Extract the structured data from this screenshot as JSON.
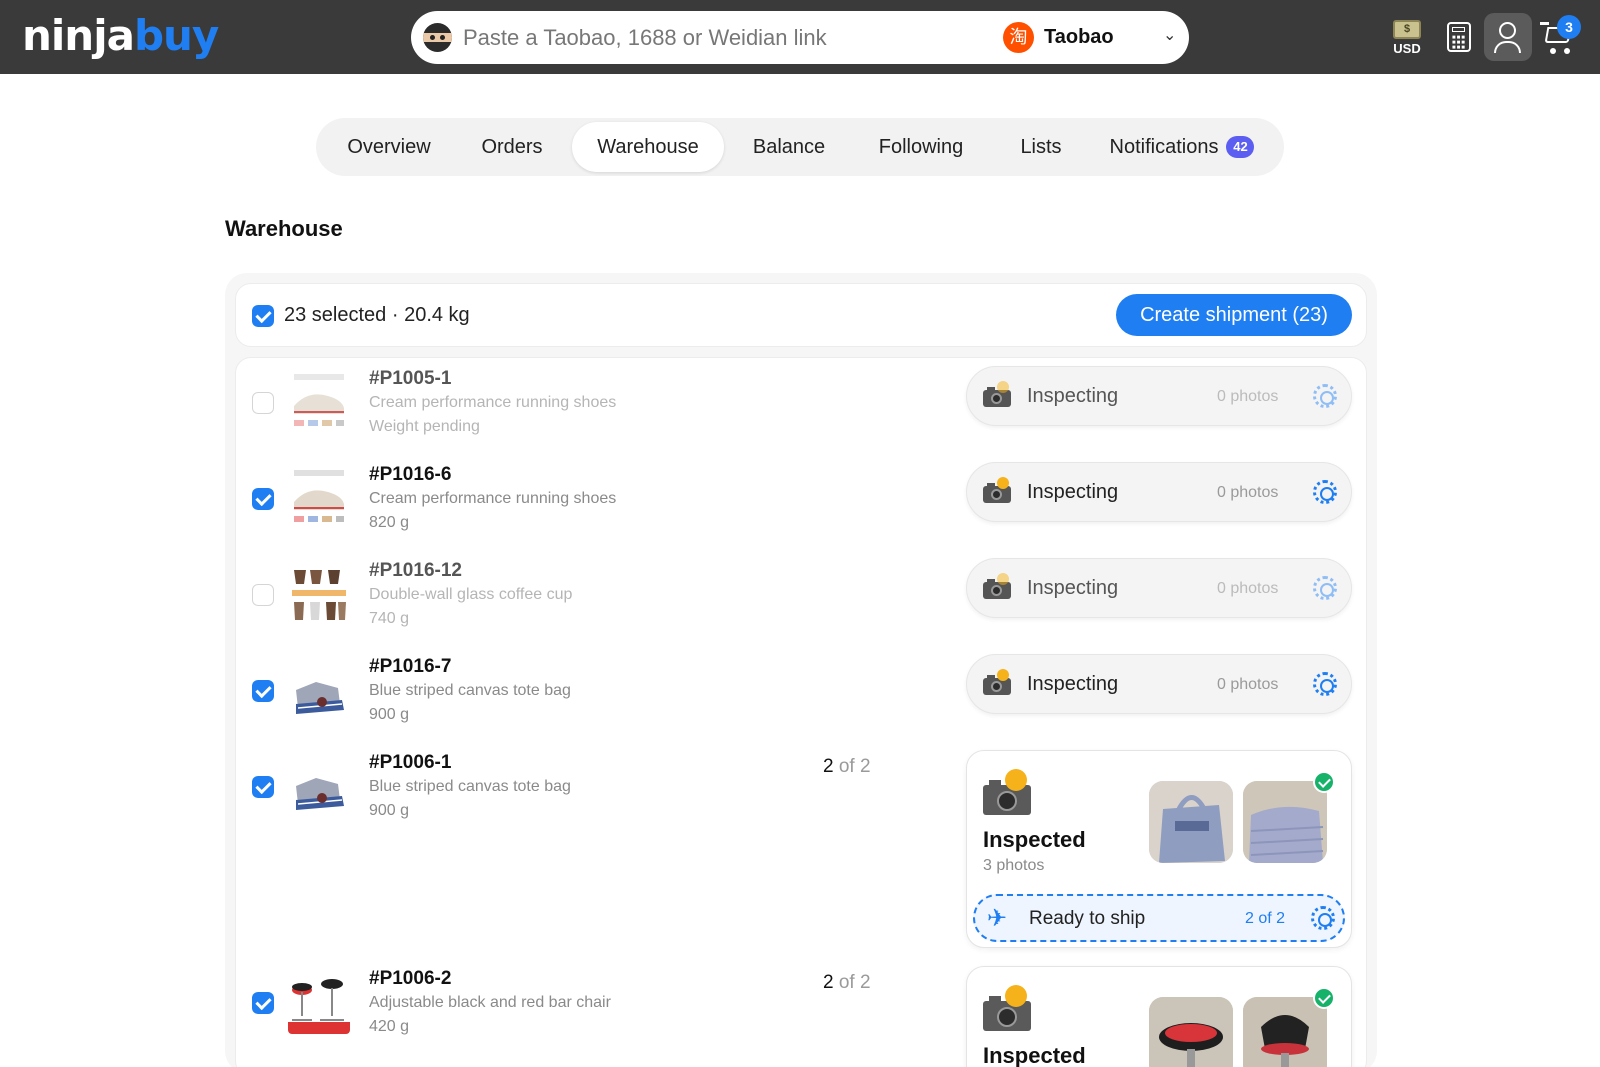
{
  "header": {
    "logo_part1": "ninja",
    "logo_part2": "buy",
    "search_placeholder": "Paste a Taobao, 1688 or Weidian link",
    "platform_label": "Taobao",
    "platform_glyph": "淘",
    "currency_label": "USD",
    "cart_count": "3"
  },
  "tabs": [
    {
      "label": "Overview"
    },
    {
      "label": "Orders"
    },
    {
      "label": "Warehouse"
    },
    {
      "label": "Balance"
    },
    {
      "label": "Following"
    },
    {
      "label": "Lists"
    },
    {
      "label": "Notifications",
      "badge": "42"
    }
  ],
  "page_title": "Warehouse",
  "selection": {
    "summary": "23 selected · 20.4 kg",
    "create_label": "Create shipment (23)"
  },
  "items": [
    {
      "id": "#P1005-1",
      "desc": "Cream performance running shoes",
      "weight": "Weight pending",
      "status": "Inspecting",
      "photos": "0 photos"
    },
    {
      "id": "#P1016-6",
      "desc": "Cream performance running shoes",
      "weight": "820 g",
      "status": "Inspecting",
      "photos": "0 photos"
    },
    {
      "id": "#P1016-12",
      "desc": "Double-wall glass coffee cup",
      "weight": "740 g",
      "status": "Inspecting",
      "photos": "0 photos"
    },
    {
      "id": "#P1016-7",
      "desc": "Blue striped canvas tote bag",
      "weight": "900 g",
      "status": "Inspecting",
      "photos": "0 photos"
    },
    {
      "id": "#P1006-1",
      "desc": "Blue striped canvas tote bag",
      "weight": "900 g",
      "qty_num": "2",
      "qty_of": "of 2",
      "status": "Inspected",
      "photos": "3 photos",
      "ready_label": "Ready to ship",
      "ready_count": "2 of 2"
    },
    {
      "id": "#P1006-2",
      "desc": "Adjustable black and red bar chair",
      "weight": "420 g",
      "qty_num": "2",
      "qty_of": "of 2",
      "status": "Inspected"
    }
  ],
  "colors": {
    "accent": "#1f7ef2",
    "topbar": "#3a3a3a",
    "badge": "#5b5ef0",
    "success": "#17b26a"
  }
}
